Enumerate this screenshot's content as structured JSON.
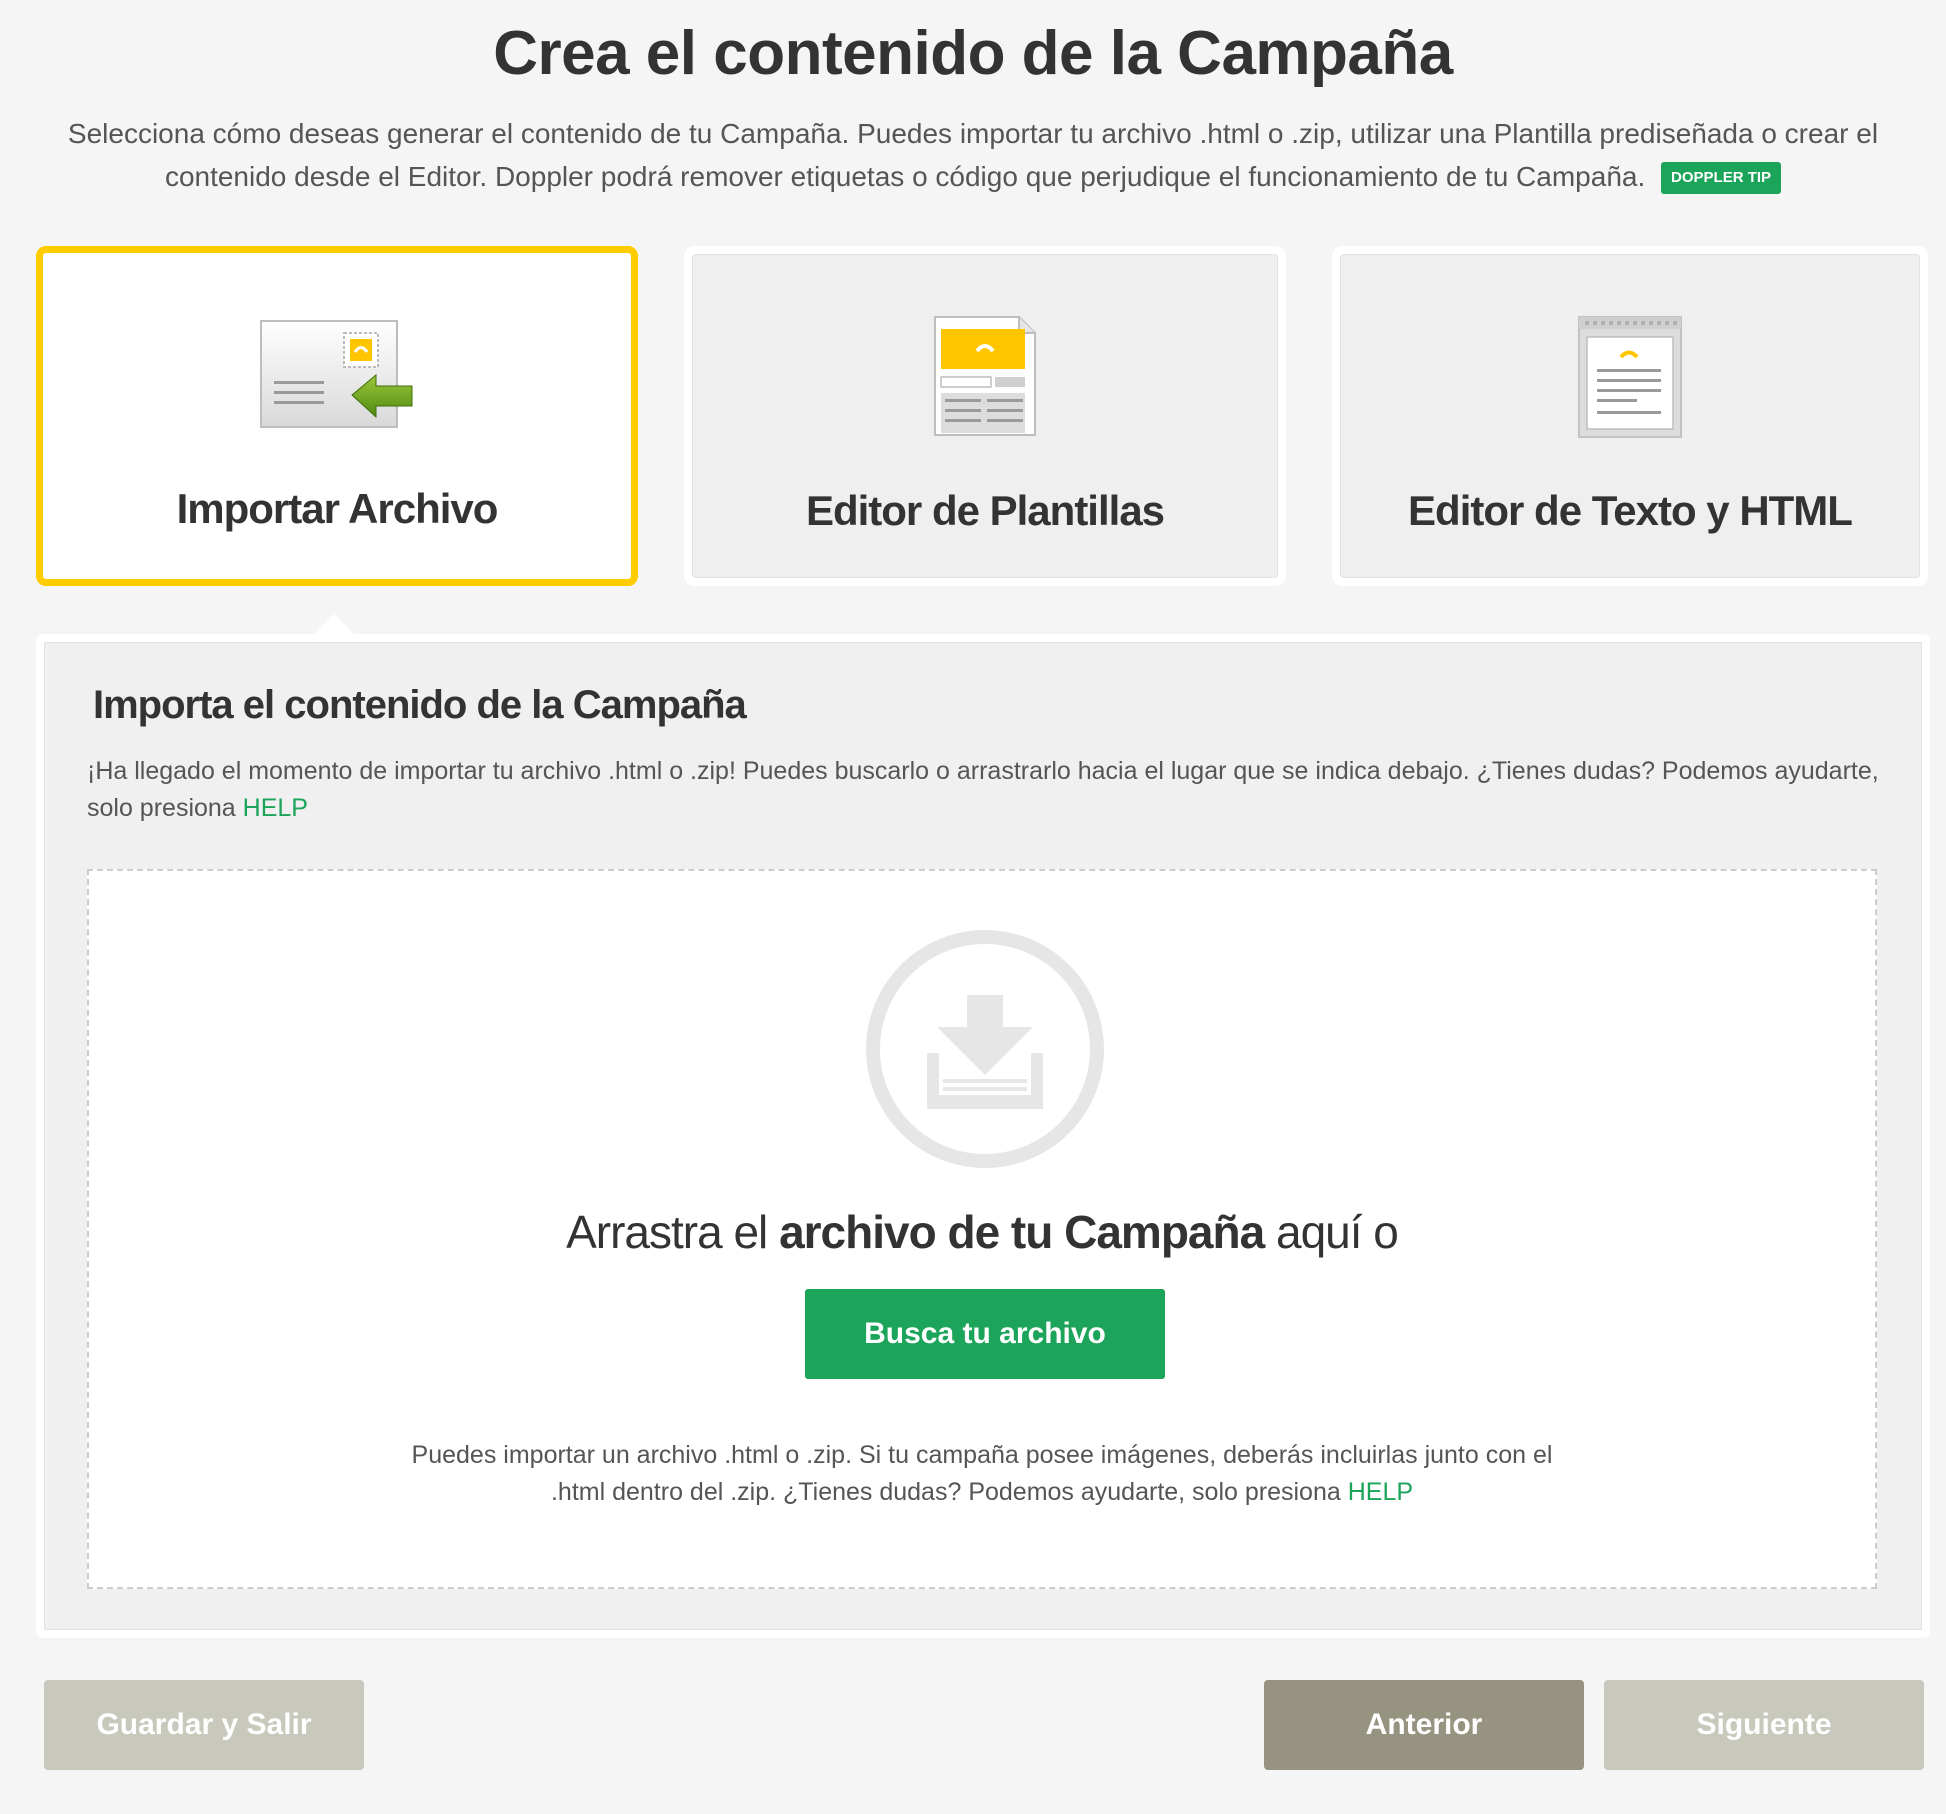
{
  "header": {
    "title": "Crea el contenido de la Campaña",
    "intro": "Selecciona cómo deseas generar el contenido de tu Campaña. Puedes importar tu archivo .html o .zip, utilizar una Plantilla prediseñada o crear el contenido desde el Editor. Doppler podrá remover etiquetas o código que perjudique el funcionamiento de tu Campaña.",
    "tip_badge": "DOPPLER TIP"
  },
  "options": [
    {
      "label": "Importar Archivo",
      "icon": "import-file-icon",
      "selected": true
    },
    {
      "label": "Editor de Plantillas",
      "icon": "template-editor-icon",
      "selected": false
    },
    {
      "label": "Editor de Texto y HTML",
      "icon": "text-html-editor-icon",
      "selected": false
    }
  ],
  "panel": {
    "title": "Importa el contenido de la Campaña",
    "desc": "¡Ha llegado el momento de importar tu archivo .html o .zip! Puedes buscarlo o arrastrarlo hacia el lugar que se indica debajo. ¿Tienes dudas? Podemos ayudarte, solo presiona",
    "help_link": "HELP",
    "dropzone": {
      "icon": "upload-tray-icon",
      "text_before": "Arrastra el",
      "text_bold": "archivo de tu Campaña",
      "text_after": "aquí o",
      "button": "Busca tu archivo",
      "help_text": "Puedes importar un archivo .html o .zip. Si tu campaña posee imágenes, deberás incluirlas junto con el .html dentro del .zip. ¿Tienes dudas? Podemos ayudarte, solo presiona",
      "help_link": "HELP"
    }
  },
  "footer": {
    "save_exit": "Guardar y Salir",
    "previous": "Anterior",
    "next": "Siguiente"
  },
  "colors": {
    "accent_green": "#1ba45a",
    "selected_border": "#ffcc00",
    "button_dark": "#969480",
    "button_disabled": "#c9c8bd"
  }
}
